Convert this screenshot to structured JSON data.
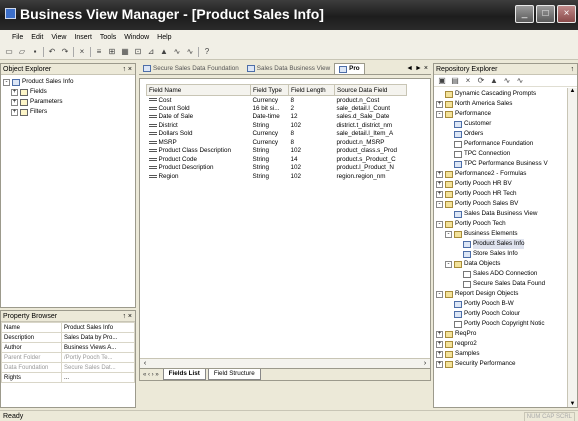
{
  "window": {
    "title": "Business View Manager - [Product Sales Info]"
  },
  "menu": [
    "File",
    "Edit",
    "View",
    "Insert",
    "Tools",
    "Window",
    "Help"
  ],
  "object_explorer": {
    "title": "Object Explorer",
    "pin": "↑ ×",
    "items": [
      {
        "label": "Product Sales Info",
        "expander": "-",
        "level": 0,
        "icon": "view-icon"
      },
      {
        "label": "Fields",
        "expander": "+",
        "level": 1,
        "icon": "fields-icon"
      },
      {
        "label": "Parameters",
        "expander": "+",
        "level": 1,
        "icon": "parameters-icon"
      },
      {
        "label": "Filters",
        "expander": "+",
        "level": 1,
        "icon": "filters-icon"
      }
    ]
  },
  "property_browser": {
    "title": "Property Browser",
    "pin": "↑ ×",
    "rows": [
      {
        "key": "Name",
        "value": "Product Sales Info",
        "dim": false
      },
      {
        "key": "Description",
        "value": "Sales Data by Pro...",
        "dim": false
      },
      {
        "key": "Author",
        "value": "Business Views A...",
        "dim": false
      },
      {
        "key": "Parent Folder",
        "value": "/Portly Pooch Te...",
        "dim": true
      },
      {
        "key": "Data Foundation",
        "value": "Secure Sales Dat...",
        "dim": true
      },
      {
        "key": "Rights",
        "value": "...",
        "dim": false
      }
    ]
  },
  "doc_tabs": [
    {
      "label": "Secure Sales Data Foundation",
      "active": false
    },
    {
      "label": "Sales Data Business View",
      "active": false
    },
    {
      "label": "Pro",
      "active": true
    }
  ],
  "doc_tab_nav": "◄ ► ×",
  "fields_grid": {
    "columns": [
      "Field Name",
      "Field Type",
      "Field Length",
      "Source Data Field"
    ],
    "rows": [
      [
        "Cost",
        "Currency",
        "8",
        "product.n_Cost"
      ],
      [
        "Count Sold",
        "16 bit si...",
        "2",
        "sale_detail.l_Count"
      ],
      [
        "Date of Sale",
        "Date-time",
        "12",
        "sales.d_Sale_Date"
      ],
      [
        "District",
        "String",
        "102",
        "district.t_district_nm"
      ],
      [
        "Dollars Sold",
        "Currency",
        "8",
        "sale_detail.l_Item_A"
      ],
      [
        "MSRP",
        "Currency",
        "8",
        "product.n_MSRP"
      ],
      [
        "Product Class Description",
        "String",
        "102",
        "product_class.s_Prod"
      ],
      [
        "Product Code",
        "String",
        "14",
        "product.s_Product_C"
      ],
      [
        "Product Description",
        "String",
        "102",
        "product.l_Product_N"
      ],
      [
        "Region",
        "String",
        "102",
        "region.region_nm"
      ]
    ]
  },
  "sheet_tabs": {
    "nav": "« ‹ › »",
    "tabs": [
      "Fields List",
      "Field Structure"
    ],
    "active": 0
  },
  "repository_explorer": {
    "title": "Repository Explorer",
    "pin": "↑",
    "items": [
      {
        "label": "Dynamic Cascading Prompts",
        "exp": "",
        "level": 0,
        "icon": "folder"
      },
      {
        "label": "North America Sales",
        "exp": "+",
        "level": 0,
        "icon": "folder"
      },
      {
        "label": "Performance",
        "exp": "-",
        "level": 0,
        "icon": "folder"
      },
      {
        "label": "Customer",
        "exp": "",
        "level": 1,
        "icon": "view"
      },
      {
        "label": "Orders",
        "exp": "",
        "level": 1,
        "icon": "view"
      },
      {
        "label": "Performance Foundation",
        "exp": "",
        "level": 1,
        "icon": "conn"
      },
      {
        "label": "TPC Connection",
        "exp": "",
        "level": 1,
        "icon": "conn"
      },
      {
        "label": "TPC Performance Business V",
        "exp": "",
        "level": 1,
        "icon": "view"
      },
      {
        "label": "Performance2 - Formulas",
        "exp": "+",
        "level": 0,
        "icon": "folder"
      },
      {
        "label": "Portly Pooch HR BV",
        "exp": "+",
        "level": 0,
        "icon": "folder"
      },
      {
        "label": "Portly Pooch HR Tech",
        "exp": "+",
        "level": 0,
        "icon": "folder"
      },
      {
        "label": "Portly Pooch Sales BV",
        "exp": "-",
        "level": 0,
        "icon": "folder"
      },
      {
        "label": "Sales Data Business View",
        "exp": "",
        "level": 1,
        "icon": "view"
      },
      {
        "label": "Portly Pooch Tech",
        "exp": "-",
        "level": 0,
        "icon": "folder"
      },
      {
        "label": "Business Elements",
        "exp": "-",
        "level": 1,
        "icon": "folder"
      },
      {
        "label": "Product Sales Info",
        "exp": "",
        "level": 2,
        "icon": "view",
        "selected": true
      },
      {
        "label": "Store Sales Info",
        "exp": "",
        "level": 2,
        "icon": "view"
      },
      {
        "label": "Data Objects",
        "exp": "-",
        "level": 1,
        "icon": "folder"
      },
      {
        "label": "Sales ADO Connection",
        "exp": "",
        "level": 2,
        "icon": "conn"
      },
      {
        "label": "Secure Sales Data Found",
        "exp": "",
        "level": 2,
        "icon": "conn"
      },
      {
        "label": "Report Design Objects",
        "exp": "-",
        "level": 0,
        "icon": "folder"
      },
      {
        "label": "Portly Pooch B-W",
        "exp": "",
        "level": 1,
        "icon": "view"
      },
      {
        "label": "Portly Pooch Colour",
        "exp": "",
        "level": 1,
        "icon": "view"
      },
      {
        "label": "Portly Pooch Copyright Notic",
        "exp": "",
        "level": 1,
        "icon": "conn"
      },
      {
        "label": "ReqPro",
        "exp": "+",
        "level": 0,
        "icon": "folder"
      },
      {
        "label": "reqpro2",
        "exp": "+",
        "level": 0,
        "icon": "folder"
      },
      {
        "label": "Samples",
        "exp": "+",
        "level": 0,
        "icon": "folder"
      },
      {
        "label": "Security Performance",
        "exp": "+",
        "level": 0,
        "icon": "folder"
      }
    ]
  },
  "status": {
    "text": "Ready",
    "locks": "NUM CAP SCRL"
  }
}
